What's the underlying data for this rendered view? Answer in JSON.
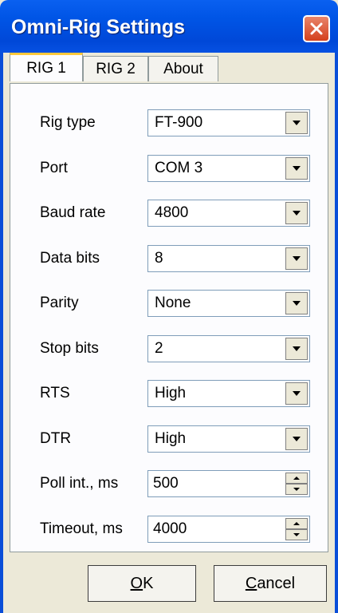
{
  "window": {
    "title": "Omni-Rig Settings"
  },
  "tabs": [
    {
      "label": "RIG 1",
      "active": true
    },
    {
      "label": "RIG 2",
      "active": false
    },
    {
      "label": "About",
      "active": false
    }
  ],
  "fields": [
    {
      "label": "Rig type",
      "value": "FT-900",
      "control": "combo"
    },
    {
      "label": "Port",
      "value": "COM 3",
      "control": "combo"
    },
    {
      "label": "Baud rate",
      "value": "4800",
      "control": "combo"
    },
    {
      "label": "Data bits",
      "value": "8",
      "control": "combo"
    },
    {
      "label": "Parity",
      "value": "None",
      "control": "combo"
    },
    {
      "label": "Stop bits",
      "value": "2",
      "control": "combo"
    },
    {
      "label": "RTS",
      "value": "High",
      "control": "combo"
    },
    {
      "label": "DTR",
      "value": "High",
      "control": "combo"
    },
    {
      "label": "Poll int., ms",
      "value": "500",
      "control": "spin"
    },
    {
      "label": "Timeout, ms",
      "value": "4000",
      "control": "spin"
    }
  ],
  "buttons": {
    "ok": {
      "mnemonic": "O",
      "rest": "K"
    },
    "cancel": {
      "mnemonic": "C",
      "rest": "ancel"
    }
  },
  "colors": {
    "titlebar": "#0055e6",
    "close": "#d4401c",
    "face": "#ece9d8",
    "tab_highlight": "#ffc83c"
  },
  "icons": {
    "close": "close-icon",
    "dropdown": "chevron-down-icon",
    "spin_up": "spin-up-icon",
    "spin_down": "spin-down-icon"
  }
}
